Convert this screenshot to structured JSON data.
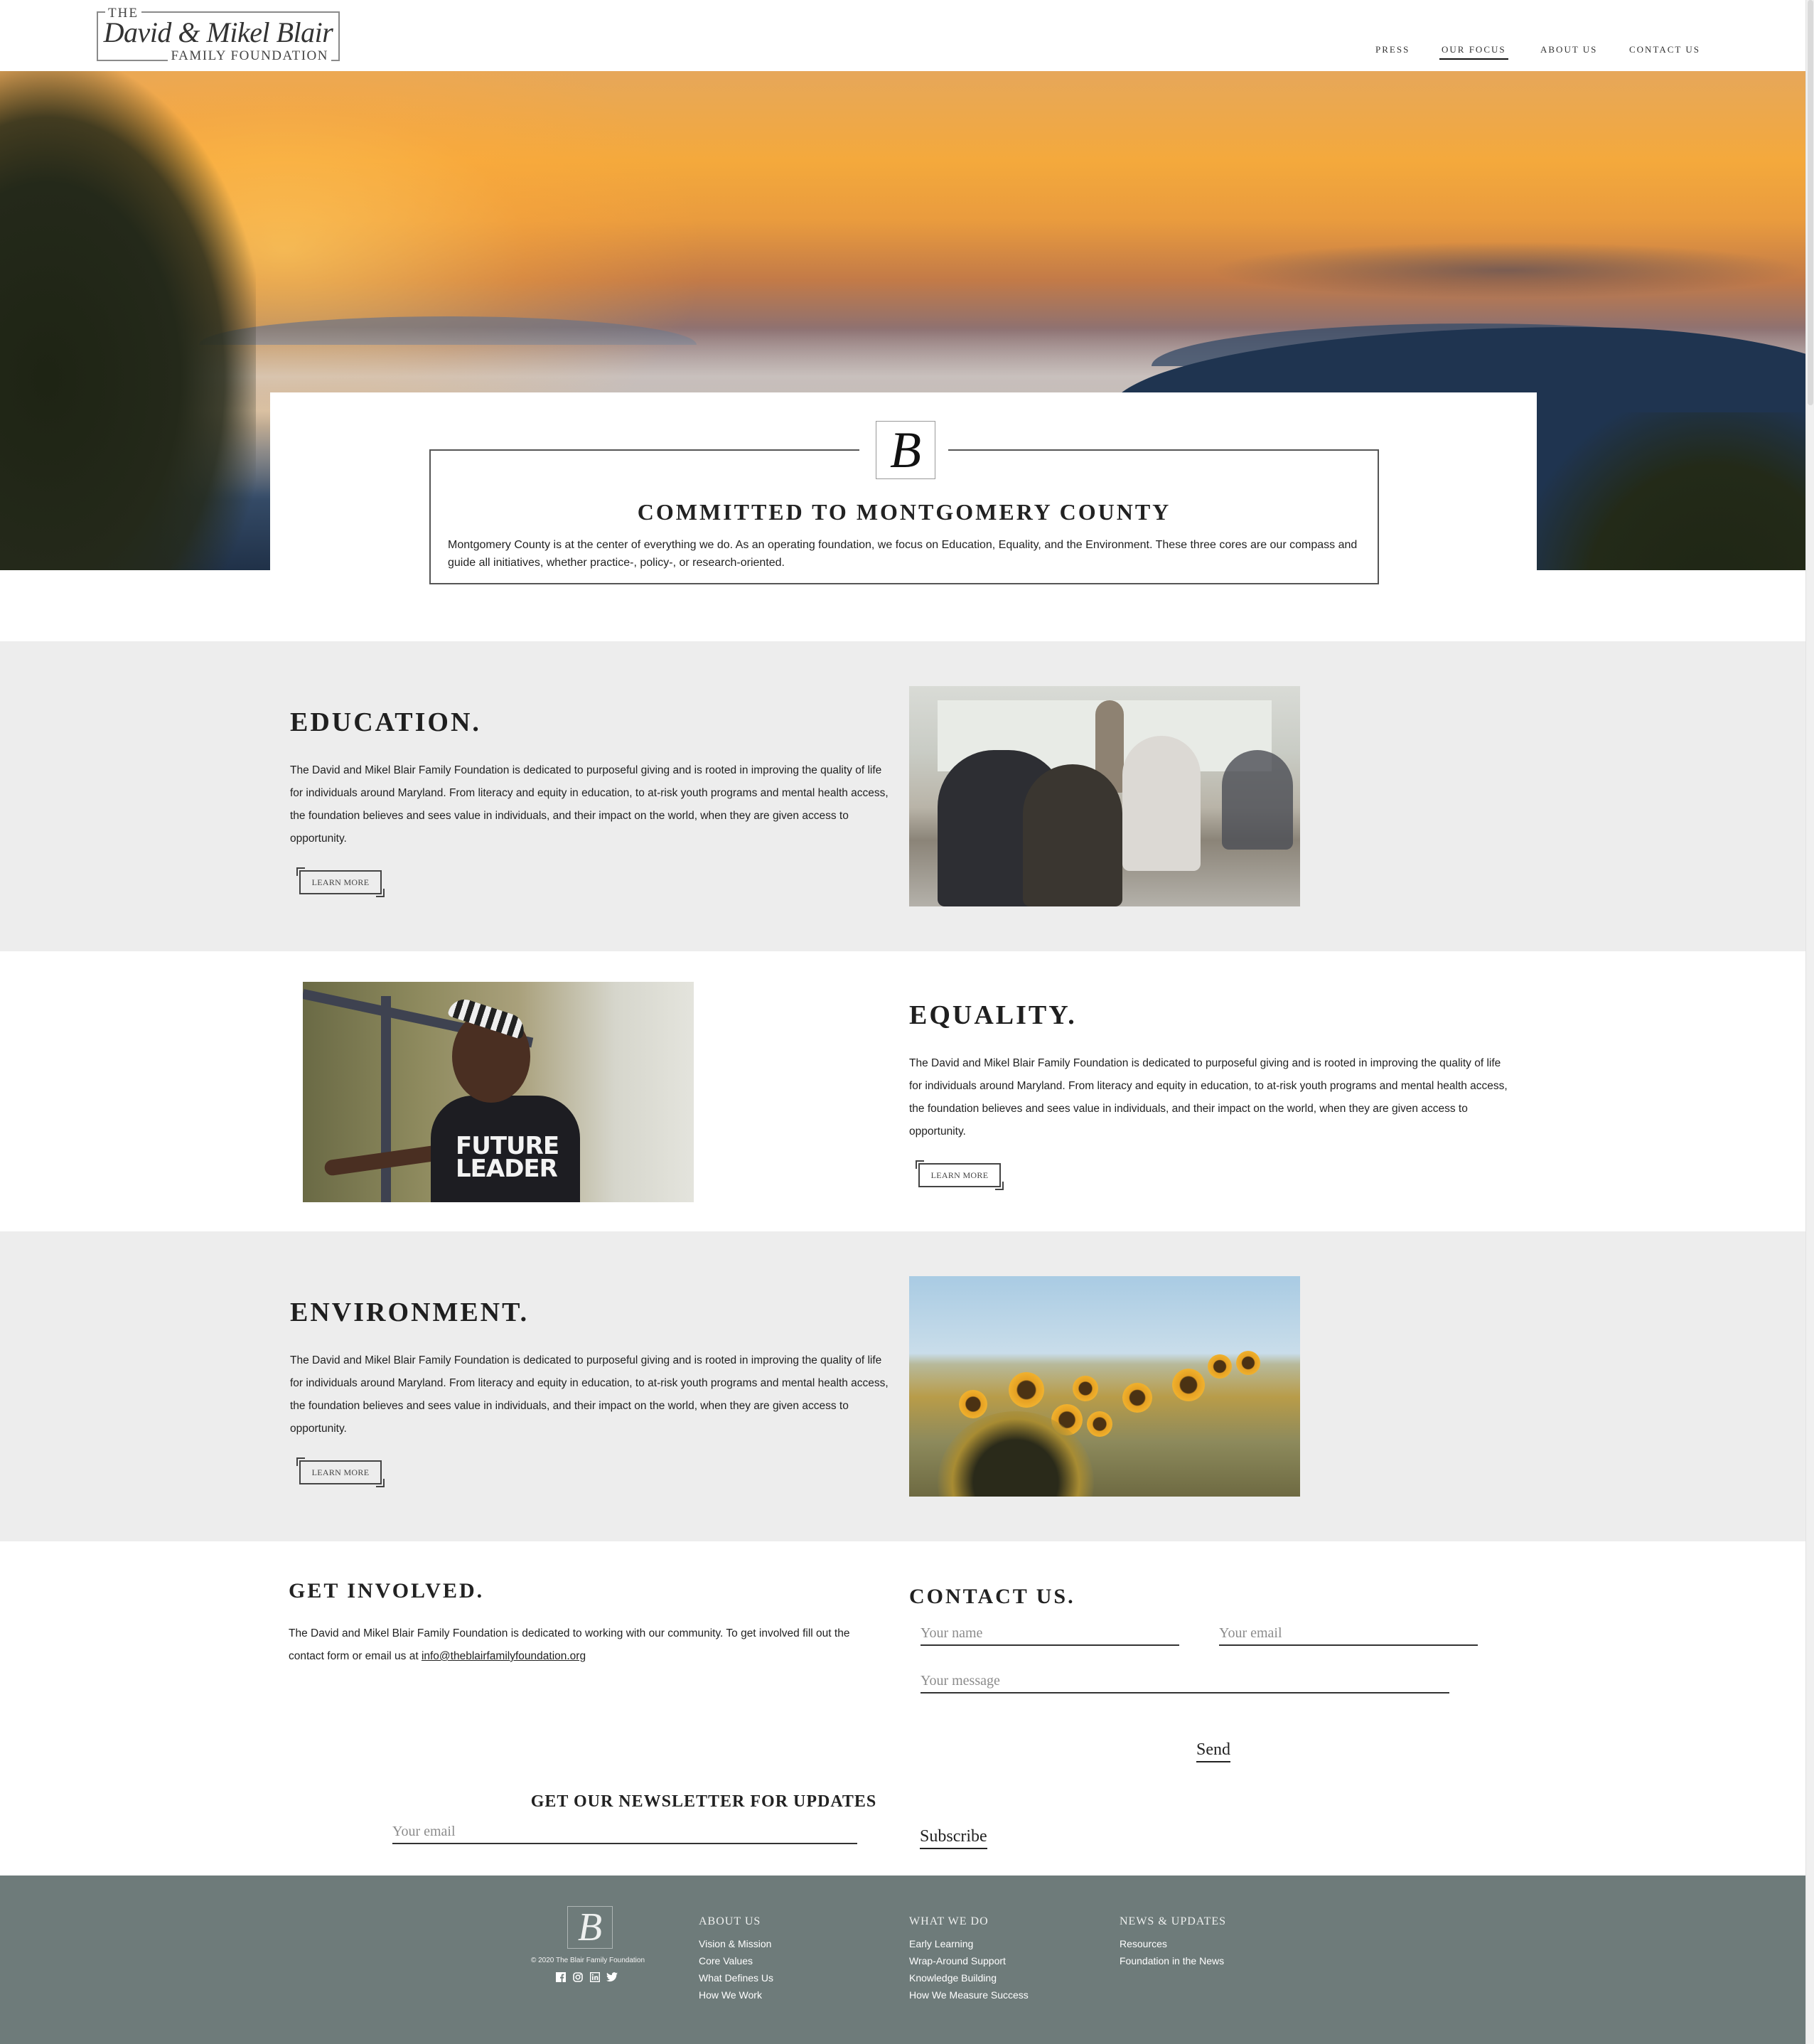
{
  "header": {
    "logo": {
      "top": "THE",
      "script": "David & Mikel Blair",
      "bottom": "FAMILY FOUNDATION"
    },
    "nav": [
      {
        "label": "PRESS",
        "active": false
      },
      {
        "label": "OUR FOCUS",
        "active": true
      },
      {
        "label": "ABOUT US",
        "active": false
      },
      {
        "label": "CONTACT US",
        "active": false
      }
    ]
  },
  "hero": {
    "image": "sunset-over-misty-mountains",
    "monogram": "B",
    "title": "COMMITTED TO MONTGOMERY COUNTY",
    "text": "Montgomery County is at the center of everything we do. As an operating foundation, we focus on Education, Equality, and the Environment. These three cores are our compass and guide all initiatives, whether practice-, policy-, or research-oriented."
  },
  "sections": [
    {
      "title": "EDUCATION.",
      "text": "The David and Mikel Blair Family Foundation is dedicated to purposeful giving and is rooted in improving the quality of life for individuals around Maryland. From literacy and equity in education, to at-risk youth programs and mental health access, the foundation believes and sees value in individuals, and their impact on the world, when they are given access to opportunity.",
      "button": "LEARN MORE",
      "image": "classroom-students-with-teacher"
    },
    {
      "title": "EQUALITY.",
      "text": "The David and Mikel Blair Family Foundation is dedicated to purposeful giving and is rooted in improving the quality of life for individuals around Maryland. From literacy and equity in education, to at-risk youth programs and mental health access, the foundation believes and sees value in individuals, and their impact on the world, when they are given access to opportunity.",
      "button": "LEARN MORE",
      "image": "smiling-girl-future-leader-shirt",
      "image_caption": "FUTURE LEADER"
    },
    {
      "title": "ENVIRONMENT.",
      "text": "The David and Mikel Blair Family Foundation is dedicated to purposeful giving and is rooted in improving the quality of life for individuals around Maryland. From literacy and equity in education, to at-risk youth programs and mental health access, the foundation believes and sees value in individuals, and their impact on the world, when they are given access to opportunity.",
      "button": "LEARN MORE",
      "image": "sunflower-field"
    }
  ],
  "get_involved": {
    "title": "GET INVOLVED.",
    "text": "The David and Mikel Blair Family Foundation is dedicated to working with our community. To get involved fill out the contact form or email us at ",
    "email": "info@theblairfamilyfoundation.org"
  },
  "contact": {
    "title": "CONTACT US.",
    "name_placeholder": "Your name",
    "email_placeholder": "Your email",
    "message_placeholder": "Your message",
    "send_label": "Send"
  },
  "newsletter": {
    "title": "GET OUR NEWSLETTER FOR UPDATES",
    "email_placeholder": "Your email",
    "subscribe_label": "Subscribe"
  },
  "footer": {
    "monogram": "B",
    "copyright": "© 2020 The Blair Family Foundation",
    "social": [
      "facebook-icon",
      "instagram-icon",
      "linkedin-icon",
      "twitter-icon"
    ],
    "columns": [
      {
        "heading": "ABOUT US",
        "links": [
          "Vision & Mission",
          "Core Values",
          "What Defines Us",
          "How We Work"
        ]
      },
      {
        "heading": "WHAT WE DO",
        "links": [
          "Early Learning",
          "Wrap-Around Support",
          "Knowledge Building",
          "How We Measure Success"
        ]
      },
      {
        "heading": "NEWS & UPDATES",
        "links": [
          "Resources",
          "Foundation in the News"
        ]
      }
    ]
  },
  "colors": {
    "footer_bg": "#6e7b7a",
    "band_grey": "#ededed",
    "text": "#222222"
  }
}
